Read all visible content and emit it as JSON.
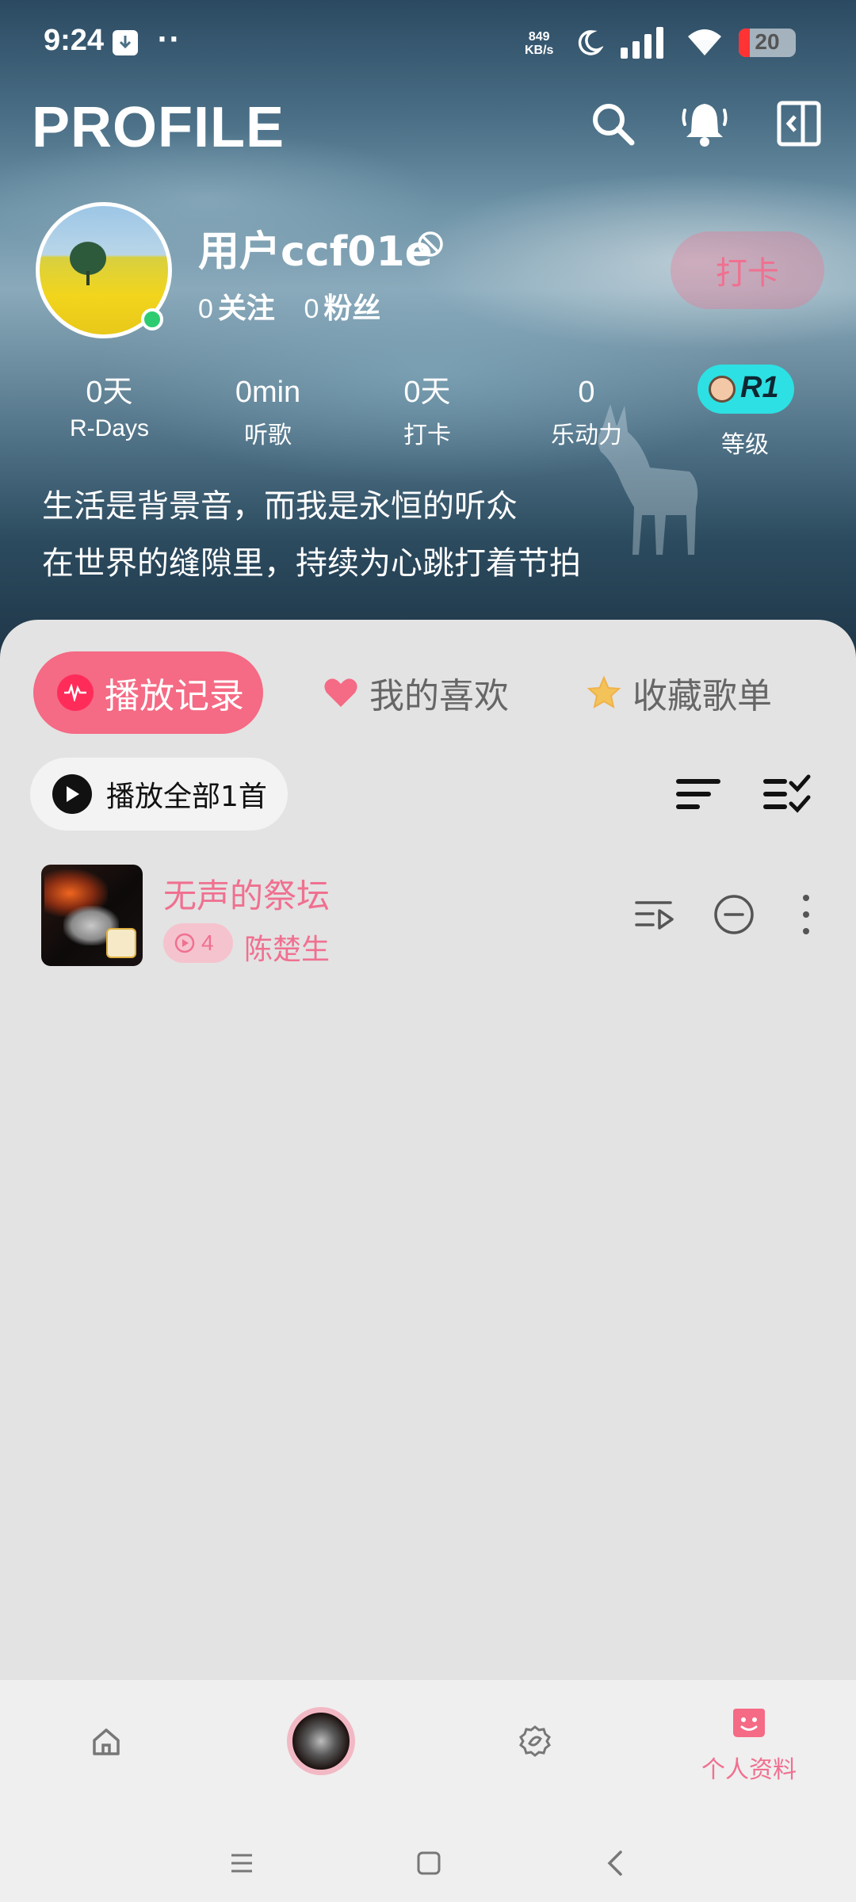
{
  "status_bar": {
    "time": "9:24",
    "net_speed_value": "849",
    "net_speed_unit": "KB/s",
    "battery": "20",
    "battery_level_percent": 20
  },
  "header": {
    "title": "PROFILE"
  },
  "profile": {
    "username": "用户ccf01e",
    "following_count": "0",
    "following_label": "关注",
    "followers_count": "0",
    "followers_label": "粉丝",
    "checkin_button": "打卡",
    "stats": [
      {
        "value": "0天",
        "label": "R-Days"
      },
      {
        "value": "0min",
        "label": "听歌"
      },
      {
        "value": "0天",
        "label": "打卡"
      },
      {
        "value": "0",
        "label": "乐动力"
      }
    ],
    "level_badge": "R1",
    "level_label": "等级",
    "bio_line1": "生活是背景音，而我是永恒的听众",
    "bio_line2": "在世界的缝隙里，持续为心跳打着节拍"
  },
  "tabs": [
    {
      "label": "播放记录",
      "active": true
    },
    {
      "label": "我的喜欢",
      "active": false
    },
    {
      "label": "收藏歌单",
      "active": false
    }
  ],
  "toolbar": {
    "play_all": "播放全部1首"
  },
  "songs": [
    {
      "title": "无声的祭坛",
      "plays": "4",
      "artist": "陈楚生"
    }
  ],
  "bottom_nav": {
    "active_label": "个人资料"
  },
  "colors": {
    "accent_pink": "#f56a84",
    "accent_text": "#f07090",
    "online": "#2ecc71",
    "level_badge": "#2de0e3"
  }
}
